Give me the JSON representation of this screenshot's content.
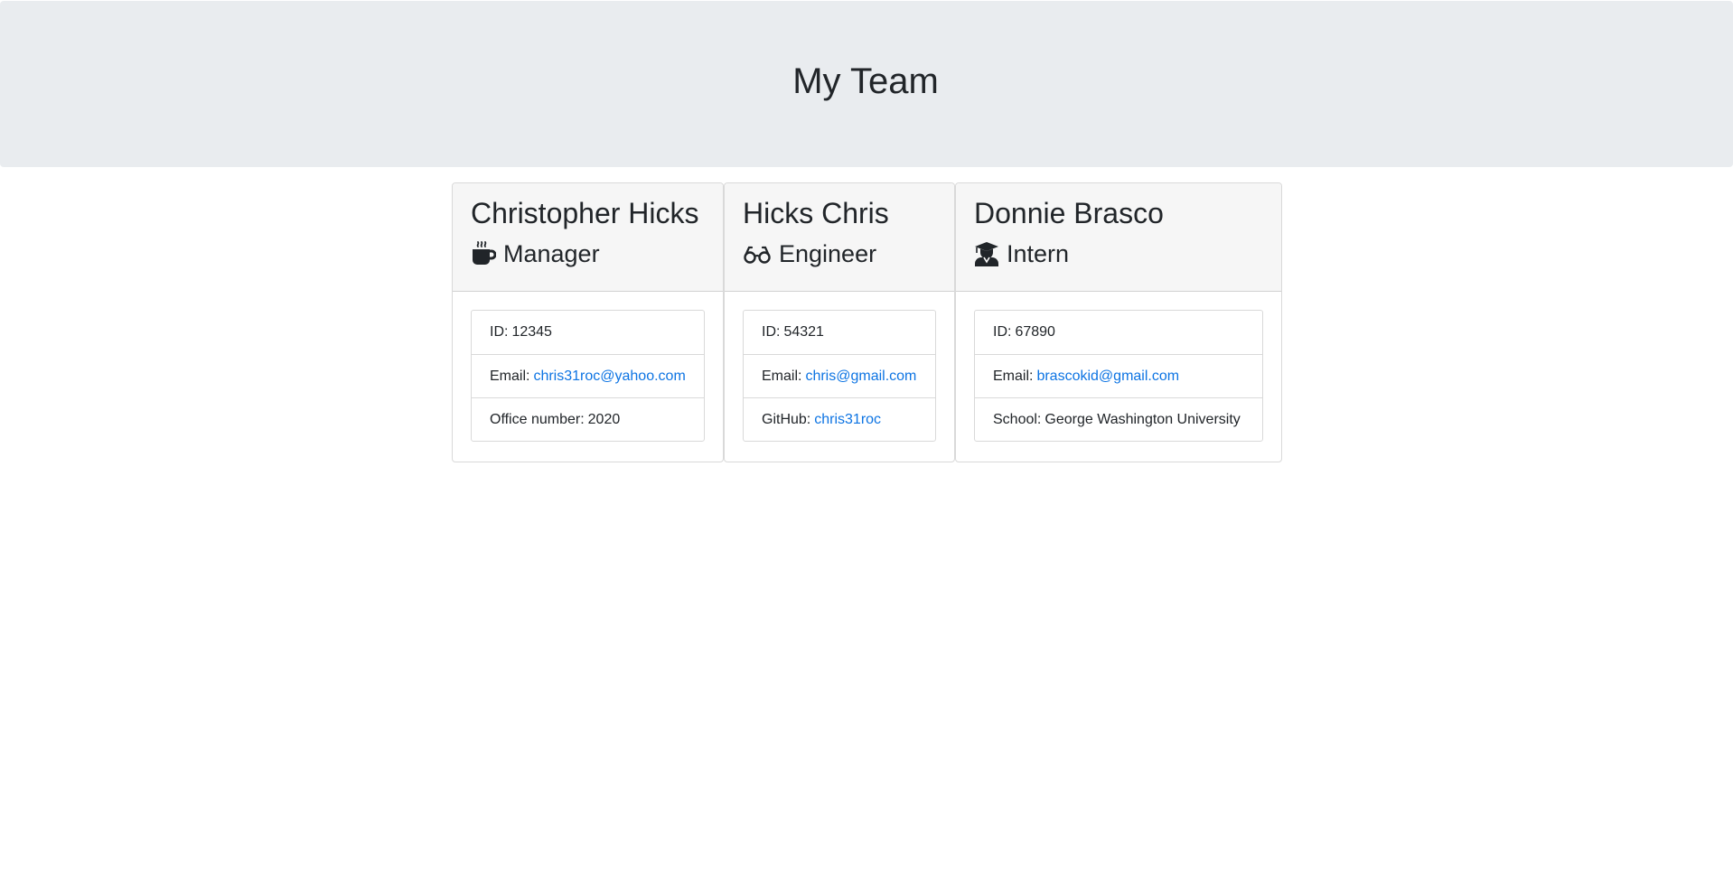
{
  "header": {
    "title": "My Team"
  },
  "team": [
    {
      "name": "Christopher Hicks",
      "role": "Manager",
      "role_icon": "coffee-icon",
      "id_label": "ID:",
      "id": "12345",
      "email_label": "Email:",
      "email": "chris31roc@yahoo.com",
      "extra_label": "Office number:",
      "extra": "2020"
    },
    {
      "name": "Hicks Chris",
      "role": "Engineer",
      "role_icon": "glasses-icon",
      "id_label": "ID:",
      "id": "54321",
      "email_label": "Email:",
      "email": "chris@gmail.com",
      "extra_label": "GitHub:",
      "extra": "chris31roc"
    },
    {
      "name": "Donnie Brasco",
      "role": "Intern",
      "role_icon": "graduate-icon",
      "id_label": "ID:",
      "id": "67890",
      "email_label": "Email:",
      "email": "brascokid@gmail.com",
      "extra_label": "School:",
      "extra": "George Washington University"
    }
  ],
  "colors": {
    "link": "#0d74e3",
    "jumbotron_bg": "#e9ecef",
    "card_header_bg": "#f6f6f6"
  }
}
